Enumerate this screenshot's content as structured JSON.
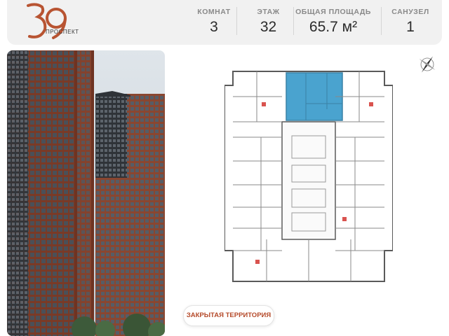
{
  "brand": {
    "logo_number": "39",
    "logo_subtitle": "ПРОСПЕКТ",
    "accent_color": "#b85432"
  },
  "stats": {
    "rooms": {
      "label": "КОМНАТ",
      "value": "3"
    },
    "floor": {
      "label": "ЭТАЖ",
      "value": "32"
    },
    "area": {
      "label": "ОБЩАЯ ПЛОЩАДЬ",
      "value": "65.7 м²"
    },
    "bathroom": {
      "label": "САНУЗЕЛ",
      "value": "1"
    }
  },
  "floorplan": {
    "highlight_color": "#4aa3cf"
  },
  "compass": {
    "icon": "compass-icon"
  },
  "actions": {
    "territory_button": "ЗАКРЫТАЯ ТЕРРИТОРИЯ"
  }
}
